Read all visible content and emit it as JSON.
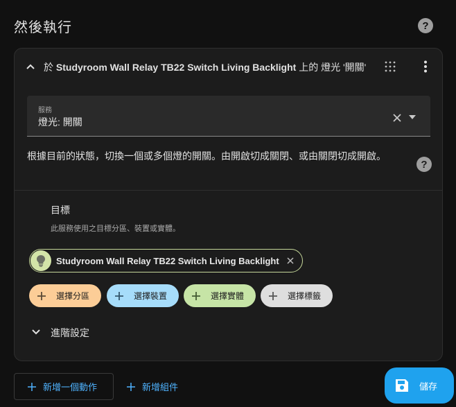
{
  "header": {
    "title": "然後執行",
    "help_icon": "help-circle-icon"
  },
  "action_card": {
    "title_prefix": "於",
    "title_device": "Studyroom Wall Relay TB22 Switch Living Backlight",
    "title_suffix": "上的 燈光 '開關'",
    "collapse_icon": "chevron-up-icon",
    "drag_icon": "drag-handle-icon",
    "menu_icon": "more-vert-icon",
    "service": {
      "label": "服務",
      "value": "燈光: 開關"
    },
    "description": "根據目前的狀態，切換一個或多個燈的開關。由開啟切成關閉、或由關閉切成開啟。",
    "target": {
      "title": "目標",
      "subtitle": "此服務使用之目標分區、裝置或實體。",
      "selected_entity": "Studyroom Wall Relay TB22 Switch Living Backlight",
      "entity_icon": "lightbulb-icon",
      "buttons": {
        "area": "選擇分區",
        "device": "選擇裝置",
        "entity": "選擇實體",
        "label": "選擇標籤"
      }
    },
    "advanced_label": "進階設定"
  },
  "footer": {
    "add_action": "新增一個動作",
    "add_block": "新增組件",
    "save": "儲存"
  },
  "colors": {
    "accent": "#4fb3ff",
    "save": "#1fa2ee",
    "area": "#fccd97",
    "device": "#a6dcfa",
    "entity": "#c6e4a6",
    "label": "#dedede"
  }
}
